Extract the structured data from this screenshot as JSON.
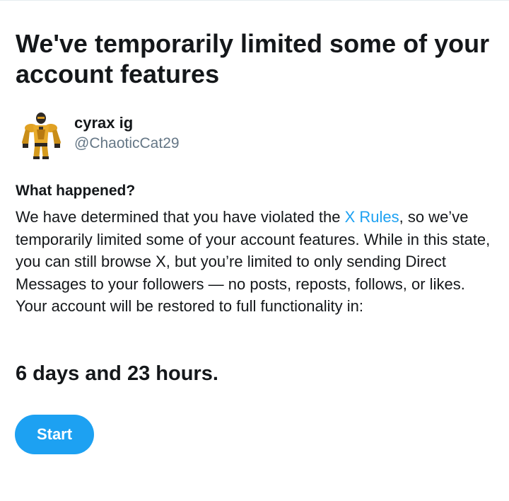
{
  "page": {
    "title": "We've temporarily limited some of your account features"
  },
  "profile": {
    "display_name": "cyrax ig",
    "handle": "@ChaoticCat29",
    "avatar_icon": "armored-character-avatar"
  },
  "notice": {
    "heading": "What happened?",
    "text_before_link": "We have determined that you have violated the ",
    "link_label": "X Rules",
    "text_after_link": ", so we’ve temporarily limited some of your account features. While in this state, you can still browse X, but you’re limited to only sending Direct Messages to your followers — no posts, reposts, follows, or likes. Your account will be restored to full functionality in:"
  },
  "countdown": {
    "remaining": "6 days and 23 hours."
  },
  "actions": {
    "start_label": "Start"
  },
  "colors": {
    "accent": "#1da1f2",
    "text": "#14171a",
    "secondary_text": "#657786"
  }
}
